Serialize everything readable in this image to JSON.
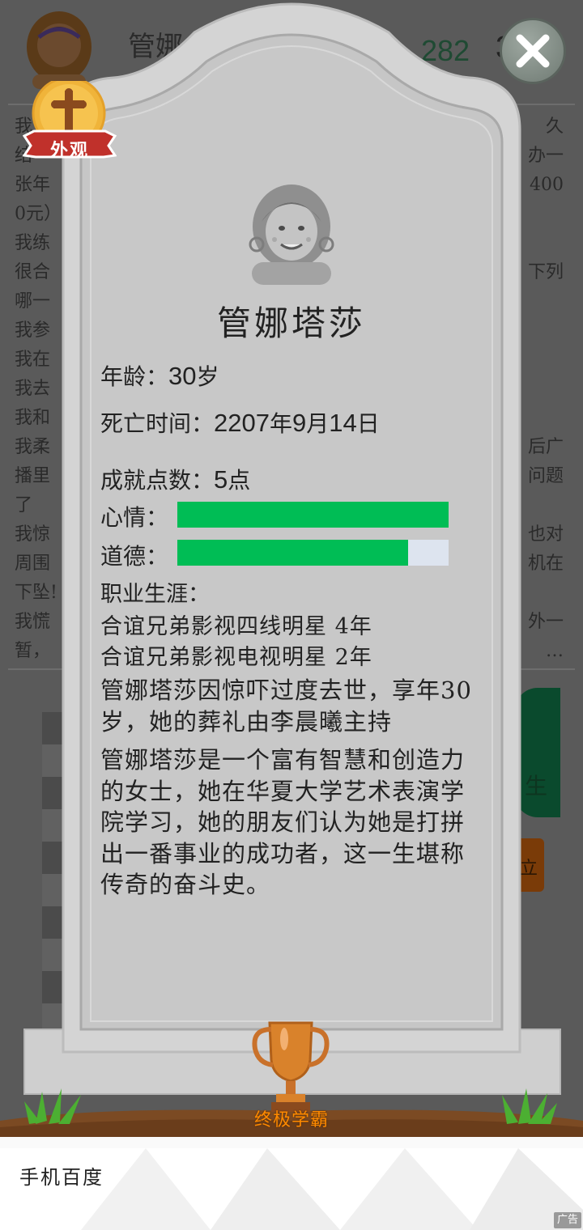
{
  "background": {
    "player_name": "管娜",
    "stat_value": "282",
    "stat_partial": "3",
    "log_left": [
      "我",
      "结",
      "张年",
      "0元）",
      "我练",
      "很合",
      "哪一",
      "我参",
      "我在",
      "我去",
      "我和",
      "我柔",
      "播里",
      "了",
      "我惊",
      "周围",
      "下坠!",
      "我慌",
      "暂，"
    ],
    "log_right": [
      "久",
      "办一",
      "400",
      "",
      "",
      "下列",
      "",
      "",
      "",
      "",
      "",
      "后广",
      "问题",
      "",
      "也对",
      "机在",
      "",
      "外一",
      "…"
    ],
    "green_button_label": "生",
    "orange_button_label": "立"
  },
  "appearance_badge": {
    "label": "外观",
    "icon": "cross-icon"
  },
  "close_button": {
    "icon": "close-icon"
  },
  "tombstone": {
    "name": "管娜塔莎",
    "age_label": "年龄：",
    "age_value": "30",
    "age_unit": "岁",
    "death_label": "死亡时间：",
    "death_year": "2207",
    "death_month": "9",
    "death_day": "14",
    "achievement_label": "成就点数：",
    "achievement_value": "5",
    "achievement_unit": "点",
    "mood_label": "心情：",
    "mood_value": 1.0,
    "morality_label": "道德：",
    "morality_value": 0.85,
    "career_title": "职业生涯：",
    "career": [
      {
        "text": "合谊兄弟影视四线明星",
        "years": "4年"
      },
      {
        "text": "合谊兄弟影视电视明星",
        "years": "2年"
      }
    ],
    "death_text": "管娜塔莎因惊吓过度去世，享年30岁，她的葬礼由李晨曦主持",
    "bio": "管娜塔莎是一个富有智慧和创造力的女士，她在华夏大学艺术表演学院学习，她的朋友们认为她是打拼出一番事业的成功者，这一生堪称传奇的奋斗史。",
    "trophy_label": "终极学霸",
    "trophy_icon": "trophy-icon"
  },
  "ad": {
    "text": "手机百度",
    "tag": "广告"
  },
  "colors": {
    "bar_fill": "#00bd55",
    "bar_track": "#dde4ef",
    "tomb": "#c9c9c9",
    "trophy_label": "#ff8a00"
  }
}
